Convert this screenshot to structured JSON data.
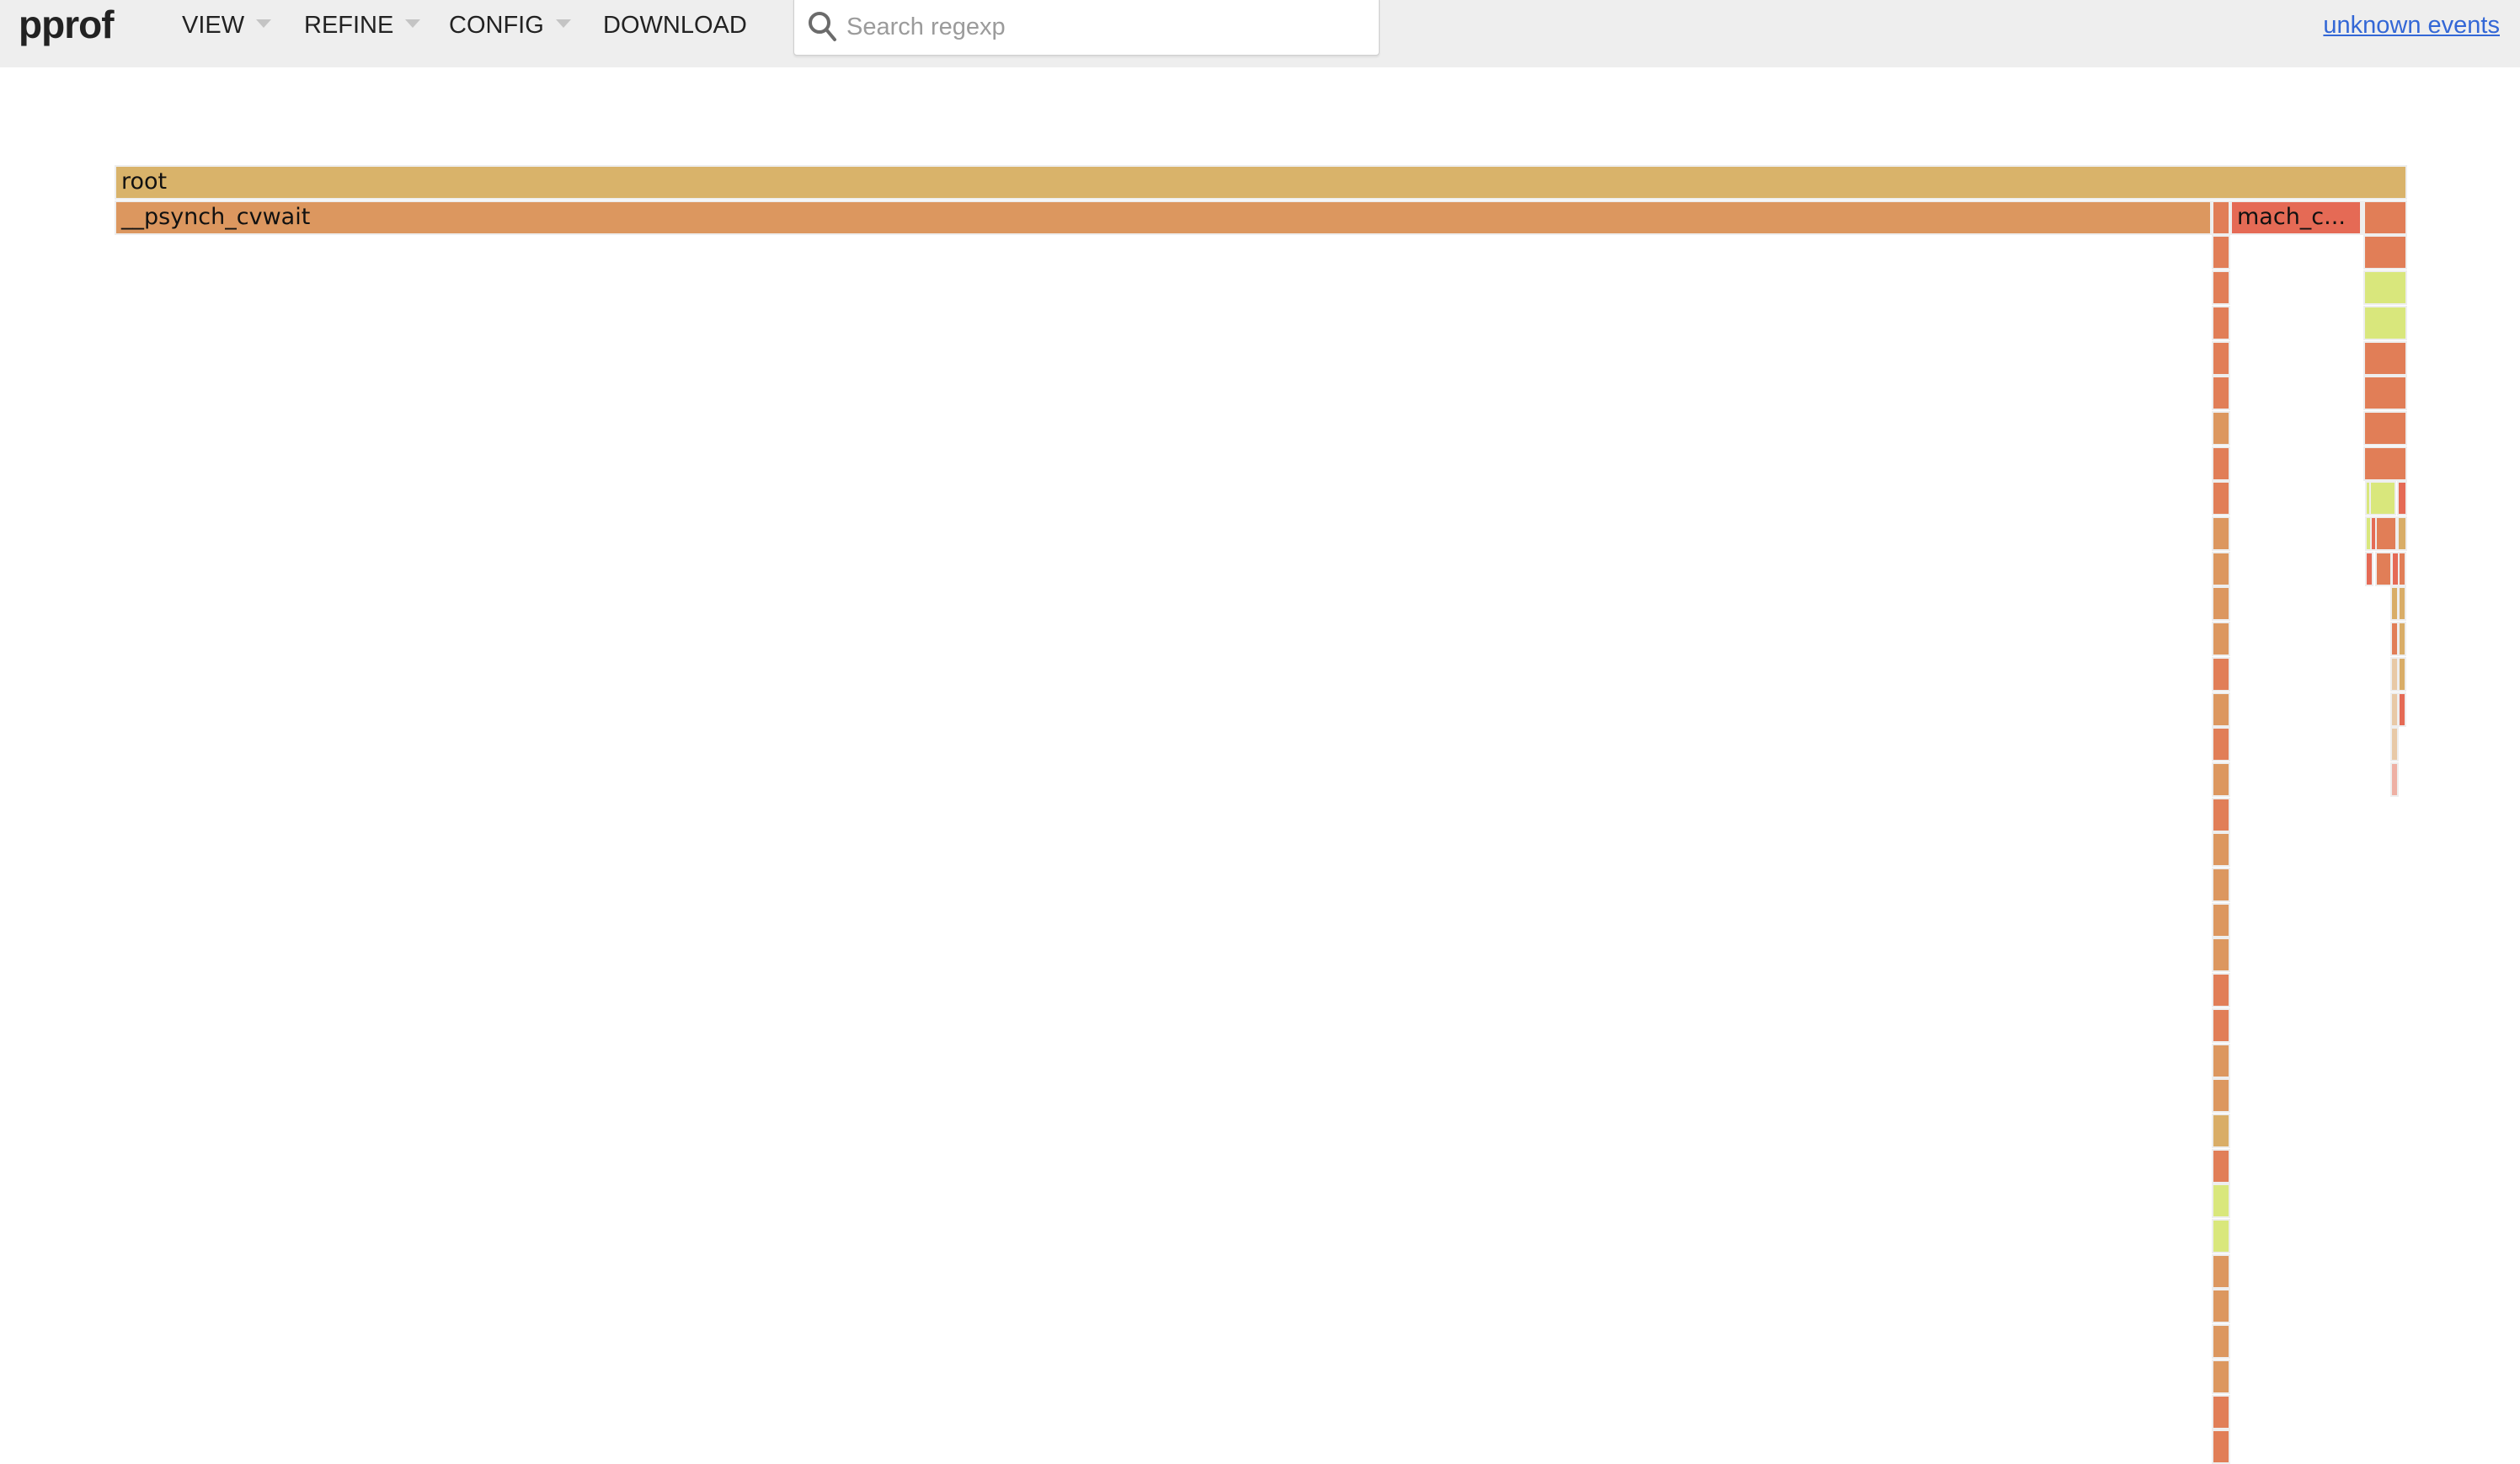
{
  "header": {
    "logo": "pprof",
    "menus": [
      {
        "label": "VIEW",
        "has_caret": true
      },
      {
        "label": "REFINE",
        "has_caret": true
      },
      {
        "label": "CONFIG",
        "has_caret": true
      },
      {
        "label": "DOWNLOAD",
        "has_caret": false
      }
    ],
    "search": {
      "placeholder": "Search regexp",
      "value": "",
      "icon": "search-icon"
    },
    "events_link": "unknown events"
  },
  "flamegraph": {
    "colors": {
      "root": "#d9b36a",
      "orange": "#dc975f",
      "orange_red": "#e17e57",
      "red": "#e56a55",
      "yellow_green": "#d9e77c",
      "tan": "#d9ad67",
      "pale": "#e8c9a6",
      "pink": "#eeb0a4",
      "separator": "#eeeeee"
    },
    "frames": [
      {
        "label": "root",
        "share": 1.0
      },
      {
        "label": "__psynch_cvwait",
        "share": 0.915
      },
      {
        "label": "mach_c...",
        "share": 0.056
      }
    ],
    "unlabeled_left_tower_depth": 34,
    "unlabeled_right_tower_depth": 17
  }
}
